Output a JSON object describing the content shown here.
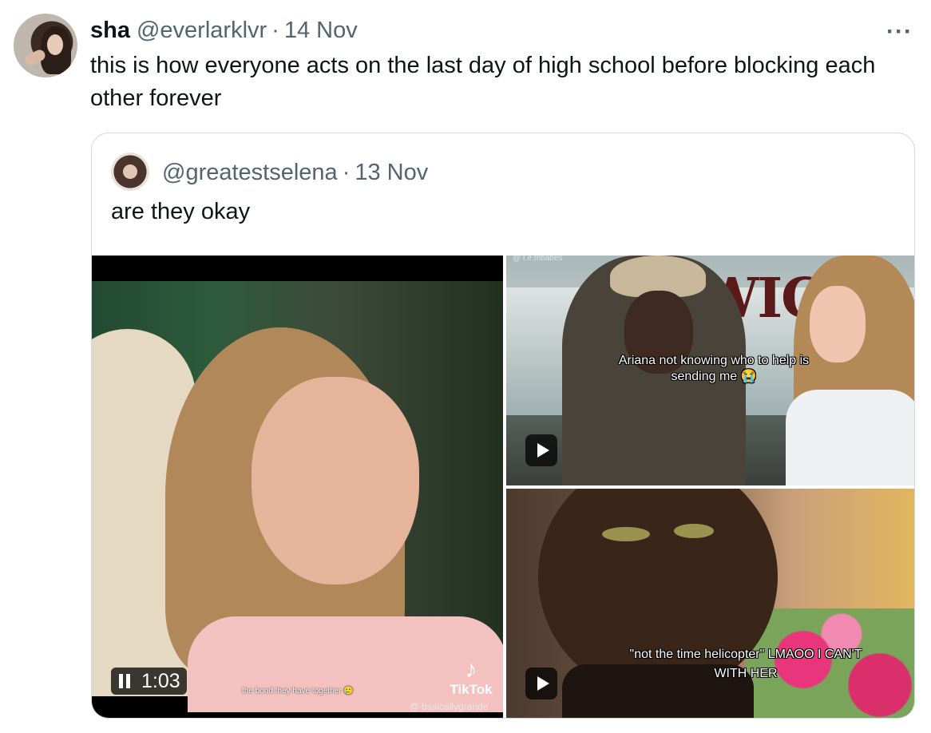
{
  "tweet": {
    "author_name": "sha",
    "author_handle": "@everlarklvr",
    "separator": "·",
    "date": "14 Nov",
    "more_label": "···",
    "text": "this is how everyone acts on the last day of high school before blocking each other forever"
  },
  "quoted_tweet": {
    "author_handle": "@greatestselena",
    "separator": "·",
    "date": "13 Nov",
    "text": "are they okay",
    "media": [
      {
        "caption": "the bond they have together 🥲",
        "watermark_brand": "TikTok",
        "watermark_user": "@ basicallygrande",
        "timestamp": "1:03",
        "state": "playing"
      },
      {
        "watermark": "@ r.e.mbabes",
        "overlay_title": "WICK",
        "caption": "Ariana not knowing who to help is sending me 😭"
      },
      {
        "caption": "\"not the time helicopter\" LMAOO I CAN'T WITH HER"
      }
    ]
  }
}
